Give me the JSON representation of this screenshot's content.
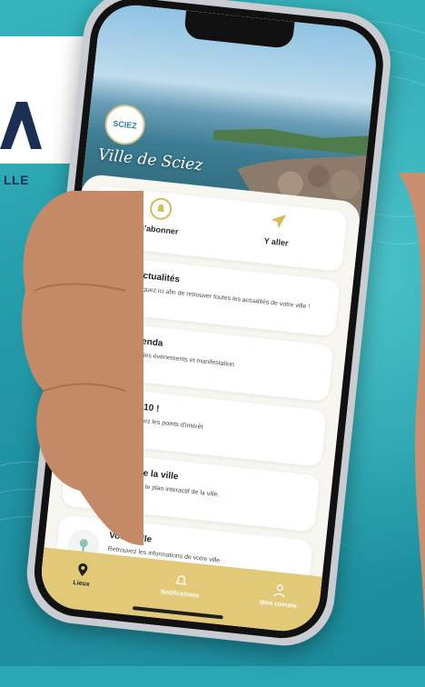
{
  "brand": {
    "logo_text": "A",
    "tagline": "LLE"
  },
  "hero": {
    "badge_text": "SCIEZ",
    "title": "Ville de Sciez"
  },
  "quick_actions": [
    {
      "label": "S'abonner",
      "icon": "bell-plus-icon"
    },
    {
      "label": "Y aller",
      "icon": "navigation-arrow-icon"
    }
  ],
  "cards": [
    {
      "title": "Actualités",
      "desc": "Cliquez ici afin de retrouver toutes les actualités de votre ville !",
      "icon": "bell-icon"
    },
    {
      "title": "Agenda",
      "desc": "Tous les événements et manifestation",
      "icon": "calendar-icon"
    },
    {
      "title": "TOP 10 !",
      "desc": "Retrouvez les points d'intérêt",
      "icon": "star-icon"
    },
    {
      "title": "Plan de la ville",
      "desc": "Retrouvez le plan interactif de la ville.",
      "icon": "map-icon"
    },
    {
      "title": "Votre ville",
      "desc": "Retrouvez les informations de votre ville",
      "icon": "tree-icon"
    }
  ],
  "tabs": [
    {
      "label": "Lieux",
      "icon": "location-pin-icon",
      "active": true
    },
    {
      "label": "Notifications",
      "icon": "bell-outline-icon",
      "active": false
    },
    {
      "label": "Mon compte",
      "icon": "user-icon",
      "active": false
    }
  ],
  "colors": {
    "background": "#2aa7b3",
    "accent_gold": "#e2c978",
    "brand_navy": "#1b2f52"
  }
}
